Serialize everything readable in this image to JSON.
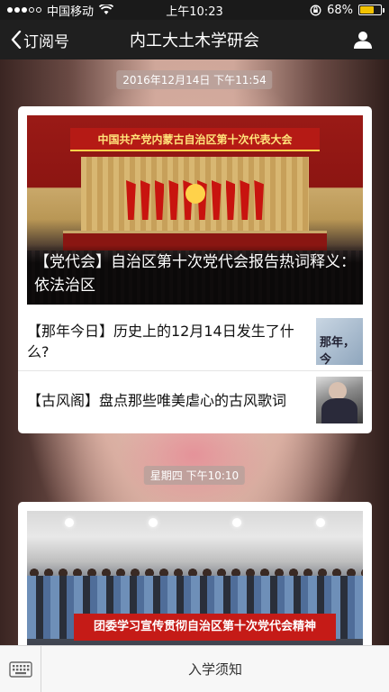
{
  "status_bar": {
    "carrier": "中国移动",
    "time": "上午10:23",
    "battery": "68%",
    "battery_level": 0.68
  },
  "nav": {
    "back_label": "订阅号",
    "title": "内工大土木学研会"
  },
  "messages": [
    {
      "timestamp": "2016年12月14日 下午11:54",
      "cover_title": "【党代会】自治区第十次党代会报告热词释义：依法治区",
      "cover_banner_text": "中国共产党内蒙古自治区第十次代表大会",
      "articles": [
        {
          "title": "【那年今日】历史上的12月14日发生了什么?",
          "thumb_text": "那年，今"
        },
        {
          "title": "【古风阁】盘点那些唯美虐心的古风歌词"
        }
      ]
    },
    {
      "timestamp": "星期四 下午10:10",
      "cover_banner_text": "团委学习宣传贯彻自治区第十次党代会精神"
    }
  ],
  "bottom_menu": {
    "item_label": "入学须知"
  },
  "colors": {
    "nav_bg": "#1f1f1f",
    "battery_fill": "#f2c200",
    "banner_red": "#c51b17"
  }
}
